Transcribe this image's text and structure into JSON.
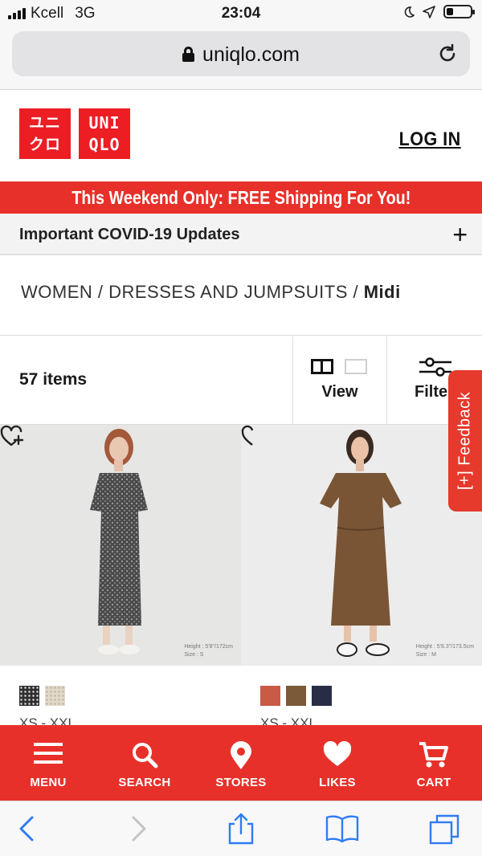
{
  "status_bar": {
    "carrier": "Kcell",
    "network": "3G",
    "time": "23:04"
  },
  "browser": {
    "host": "uniqlo.com"
  },
  "header": {
    "logo_katakana_1": "ユニ",
    "logo_katakana_2": "クロ",
    "logo_latin_1": "UNI",
    "logo_latin_2": "QLO",
    "login_label": "LOG IN"
  },
  "promo_banner": "This Weekend Only: FREE Shipping For You!",
  "covid": {
    "label": "Important COVID-19 Updates",
    "toggle": "+"
  },
  "breadcrumb": {
    "path": "WOMEN / DRESSES AND JUMPSUITS / ",
    "current": "Midi"
  },
  "toolbar": {
    "item_count": "57 items",
    "view_label": "View",
    "filter_label": "Filte"
  },
  "feedback_label": "[+] Feedback",
  "products": [
    {
      "meta_height": "Height : 5'8\"/172cm",
      "meta_size": "Size : S",
      "sizes": "XS - XXL",
      "swatches": [
        "#3a3a3a",
        "#ddd4c4"
      ]
    },
    {
      "meta_height": "Height : 5'8.3\"/173.5cm",
      "meta_size": "Size : M",
      "sizes": "XS - XXL",
      "swatches": [
        "#c95a45",
        "#7a5a37",
        "#262d45"
      ]
    }
  ],
  "bottom_nav": [
    {
      "label": "MENU",
      "icon": "menu-icon"
    },
    {
      "label": "SEARCH",
      "icon": "search-icon"
    },
    {
      "label": "STORES",
      "icon": "location-pin-icon"
    },
    {
      "label": "LIKES",
      "icon": "heart-icon"
    },
    {
      "label": "CART",
      "icon": "cart-icon"
    }
  ],
  "colors": {
    "brand_red": "#ed1d24",
    "promo_red": "#e8302a",
    "ios_blue": "#2f7cf6"
  },
  "battery_level": 0.3
}
